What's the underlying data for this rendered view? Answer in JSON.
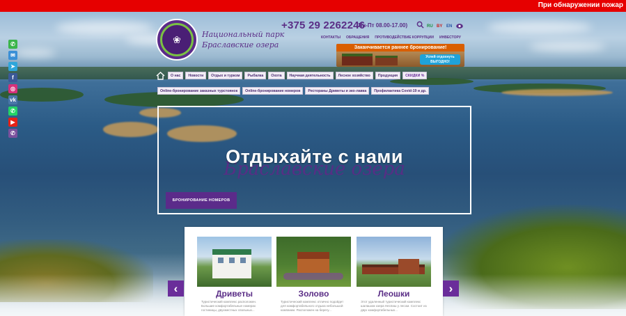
{
  "alert": {
    "text": "При обнаружении пожар"
  },
  "social": [
    {
      "icon": "phone-icon",
      "glyph": "✆",
      "color": "#3bb54a"
    },
    {
      "icon": "mail-icon",
      "glyph": "✉",
      "color": "#3a8fd6"
    },
    {
      "icon": "telegram-icon",
      "glyph": "➤",
      "color": "#2ea6da"
    },
    {
      "icon": "facebook-icon",
      "glyph": "f",
      "color": "#3b5998"
    },
    {
      "icon": "instagram-icon",
      "glyph": "◎",
      "color": "#d6307a"
    },
    {
      "icon": "vk-icon",
      "glyph": "vk",
      "color": "#4a76a8"
    },
    {
      "icon": "whatsapp-icon",
      "glyph": "✆",
      "color": "#25d366"
    },
    {
      "icon": "youtube-icon",
      "glyph": "▶",
      "color": "#e62117"
    },
    {
      "icon": "viber-icon",
      "glyph": "✆",
      "color": "#7b519d"
    }
  ],
  "header": {
    "park_name_line1": "Национальный парк",
    "park_name_line2": "Браславские озера",
    "phone": "+375 29 2262246",
    "hours": "(Пн-Пт 08.00-17.00)",
    "languages": [
      "RU",
      "BY",
      "EN"
    ],
    "top_links": [
      "КОНТАКТЫ",
      "ОБРАЩЕНИЯ",
      "ПРОТИВОДЕЙСТВИЕ КОРРУПЦИИ",
      "ИНВЕСТОРУ"
    ]
  },
  "promo": {
    "headline": "Заканчивается раннее бронирование!",
    "button": "Успей отдохнуть ВЫГОДНО!"
  },
  "nav_primary": [
    "О нас",
    "Новости",
    "Отдых и туризм",
    "Рыбалка",
    "Охота",
    "Научная деятельность",
    "Лесное хозяйство",
    "Продукция",
    "СКИДКИ %"
  ],
  "nav_secondary": [
    "Online-бронирование заказных турстоянок",
    "Online-бронирование номеров",
    "Рестораны Дриветы и эко-лавка",
    "Профилактика Covid-19 и др."
  ],
  "hero": {
    "title": "Отдыхайте с нами",
    "subtitle": "Браславские озера",
    "booking_button": "БРОНИРОВАНИЕ НОМЕРОВ"
  },
  "carousel": {
    "prev": "‹",
    "next": "›",
    "cards": [
      {
        "title": "Дриветы",
        "desc": "Туристический комплекс расположен. Большие комфортабельные номерах гостиницы, двухместных спальных..."
      },
      {
        "title": "Золово",
        "desc": "Туристический комплекс отлично подойдет для комфортабельного отдыха небольшой компании. Расположен на берегу..."
      },
      {
        "title": "Леошки",
        "desc": "Этот удаленный туристический комплекс шалашом озера Неспиш у лесом. Состоит из двух комфортабельных..."
      }
    ]
  },
  "colors": {
    "brand_purple": "#5a2d86",
    "alert_red": "#e60000",
    "promo_orange": "#d95e00"
  }
}
